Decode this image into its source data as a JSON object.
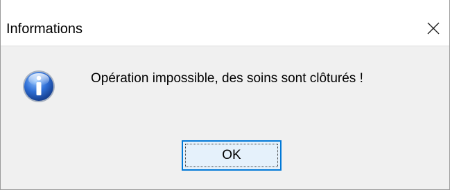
{
  "window": {
    "title": "Informations",
    "close_icon": "close-icon"
  },
  "content": {
    "icon": "info-icon",
    "message": "Opération impossible, des soins sont clôturés !"
  },
  "buttons": {
    "ok_label": "OK"
  },
  "colors": {
    "dialog_background": "#f0f0f0",
    "titlebar_background": "#ffffff",
    "button_border_focus": "#0078d7",
    "button_background": "#e5f1fb",
    "icon_blue": "#2a67c9"
  }
}
